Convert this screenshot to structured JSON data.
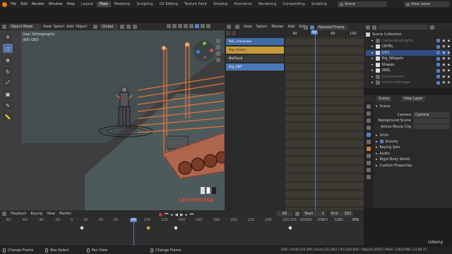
{
  "topbar": {
    "menus": [
      "File",
      "Edit",
      "Render",
      "Window",
      "Help"
    ],
    "workspace_tabs": [
      "Layout",
      "Pose",
      "Modeling",
      "Sculpting",
      "UV Editing",
      "Texture Paint",
      "Shading",
      "Animation",
      "Rendering",
      "Compositing",
      "Scripting"
    ],
    "active_tab": "Pose",
    "scene_label": "Scene",
    "view_layer_label": "View Layer"
  },
  "viewport": {
    "mode": "Object Mode",
    "menus": [
      "View",
      "Select",
      "Add",
      "Object"
    ],
    "transform_orientation": "Global",
    "overlay_title": "User Orthographic",
    "overlay_subtitle": "(68) GEO",
    "key_hint": "LEFTMOUSE",
    "tool_icons": [
      "cursor-tool",
      "select-box-tool",
      "move-tool",
      "rotate-tool",
      "scale-tool",
      "transform-tool",
      "annotate-tool",
      "measure-tool"
    ]
  },
  "nla": {
    "menus": [
      "View",
      "Select",
      "Marker",
      "Add",
      "Edit"
    ],
    "current_frame_badge": "68",
    "ruler": [
      "40",
      "60",
      "80",
      "100"
    ],
    "snap_mode": "Nearest Frame",
    "tracks": [
      {
        "name": "RIG_character",
        "color": "#3e6ba7"
      },
      {
        "name": "Rig_Action",
        "color": "#c79a3a"
      },
      {
        "name": "NlaTrack",
        "color": "#3a3a3a"
      },
      {
        "name": "Rig_ENT",
        "color": "#4a77b8"
      }
    ]
  },
  "outliner": {
    "title": "Scene Collection",
    "items": [
      {
        "name": "CameraAndLights",
        "dim": true
      },
      {
        "name": "CNTRL",
        "dim": false
      },
      {
        "name": "GEO",
        "dim": false,
        "selected": true
      },
      {
        "name": "Rig_Widgets",
        "dim": false
      },
      {
        "name": "Shapes",
        "dim": false
      },
      {
        "name": "SKEL",
        "dim": false
      },
      {
        "name": "Environment",
        "dim": true
      },
      {
        "name": "referenceImage",
        "dim": true
      }
    ]
  },
  "properties": {
    "tabs": [
      "Scene",
      "View Layer"
    ],
    "section": "Scene",
    "camera_label": "Camera",
    "camera_value": "Camera",
    "background_scene_label": "Background Scene",
    "active_movie_clip_label": "Active Movie Clip",
    "panels": [
      "Units",
      "Gravity",
      "Keying Sets",
      "Audio",
      "Rigid Body World",
      "Custom Properties"
    ]
  },
  "timeline": {
    "menus": [
      "Playback",
      "Keying",
      "View",
      "Marker"
    ],
    "current_frame": "68",
    "start_label": "Start",
    "start_value": "1",
    "end_label": "End",
    "end_value": "263",
    "ruler": [
      "-80",
      "-60",
      "-40",
      "-20",
      "0",
      "20",
      "40",
      "60",
      "80",
      "100",
      "120",
      "140",
      "160",
      "180",
      "200",
      "220",
      "240",
      "260",
      "280",
      "300",
      "320",
      "340"
    ],
    "current_marker": "68",
    "nla_ruler": [
      "20",
      "40",
      "60",
      "80",
      "100",
      "120",
      "140",
      "160",
      "180",
      "200",
      "220",
      "240",
      "260",
      "280",
      "300",
      "320",
      "340"
    ]
  },
  "statusbar": {
    "items": [
      "Change Frame",
      "Box Select",
      "Pan View",
      "Change Frame"
    ],
    "stats": "GEO | Verts:215,399 | Faces:213,963 | Tris:426,854 | Objects:35/52 | Mem: 138.8 MiB | v2.80.75"
  },
  "watermark": "Udemy",
  "colors": {
    "viewport_bg": "#3e3e3e",
    "selection_orange": "#e0733f",
    "accent_blue": "#5680c2",
    "key_red": "#d84a3a"
  }
}
